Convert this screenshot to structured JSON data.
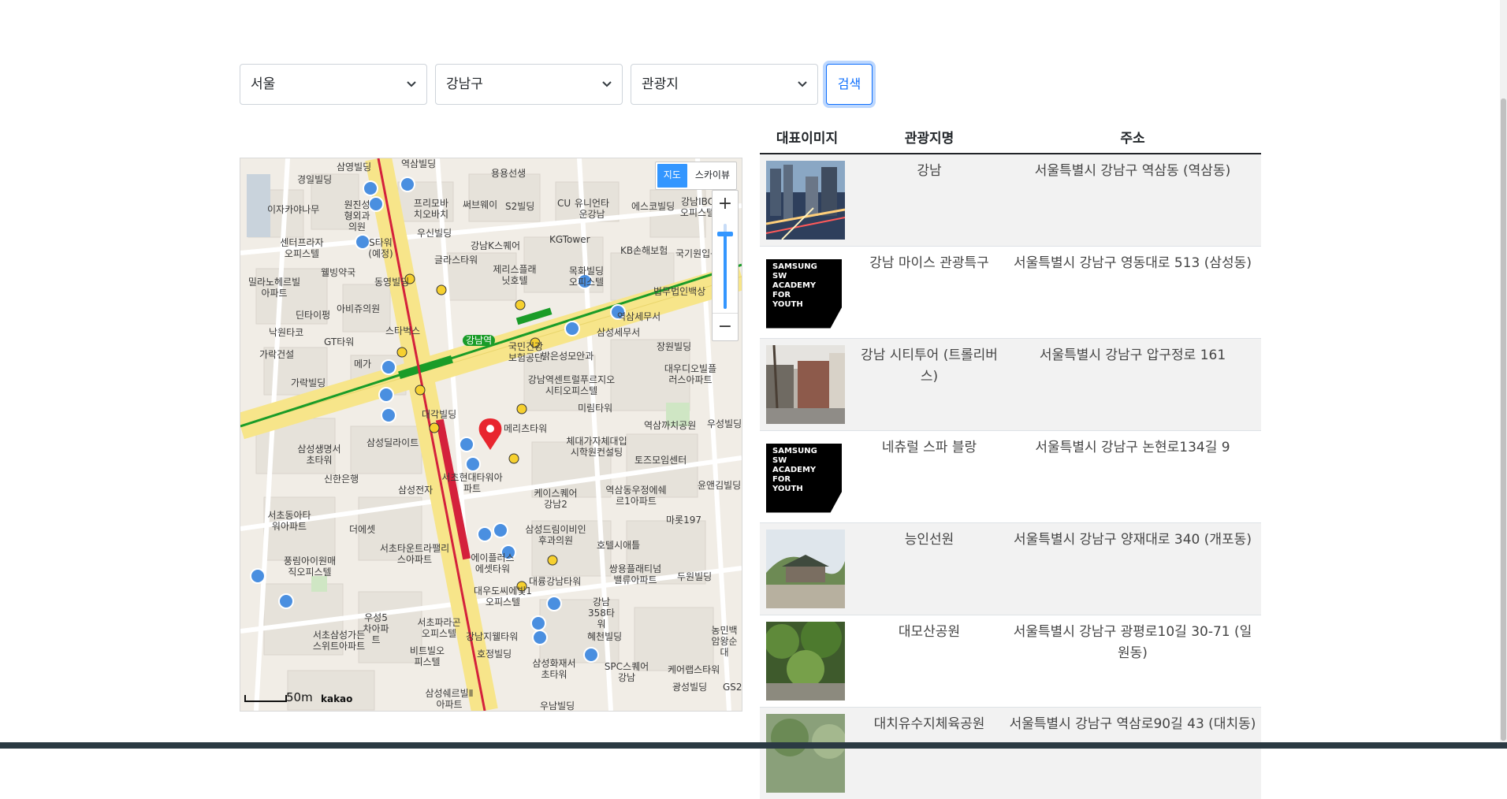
{
  "filters": {
    "sido": "서울",
    "gugun": "강남구",
    "content_type": "관광지",
    "search_label": "검색"
  },
  "map": {
    "map_type_active": "지도",
    "map_type_other": "스카이뷰",
    "zoom_in": "+",
    "zoom_out": "−",
    "scale": "50m",
    "provider": "kakao",
    "labels": [
      "삼영빌딩",
      "역삼빌딩",
      "용용선생",
      "경일빌딩",
      "이자카야나무",
      "원진성형외과의원",
      "프리모바치오바치",
      "써브웨이",
      "S2빌딩",
      "CU",
      "유니언타운강남",
      "에스코빌딩",
      "강남IBC오피스텔",
      "센터프라자오피스텔",
      "S타워(예정)",
      "우신빌딩",
      "강남K스퀘어",
      "KGTower",
      "KB손해보험",
      "국기원입구",
      "밀라노헤르빌아파트",
      "웰빙약국",
      "동영빌딩",
      "글라스타워",
      "제리스플래닛호텔",
      "목화빌딩오피스텔",
      "법무법인백상",
      "딘타이펑",
      "아비쥬의원",
      "낙원타코",
      "GT타워",
      "스타벅스",
      "역삼세무서",
      "삼성세무서",
      "가락건설",
      "메가",
      "강남역",
      "국민건강보험공단",
      "밝은성모안과",
      "장원빌딩",
      "가락빌딩",
      "강남역센트럴푸르지오시티오피스텔",
      "대우디오빌플러스아파트",
      "대각빌딩",
      "메리츠타워",
      "미림타워",
      "역삼까치공원",
      "우성빌딩",
      "삼성딜라이트",
      "체대가자체대입시학원컨설팅",
      "토즈모임센터",
      "삼성생명서초타워",
      "신한은행",
      "서초현대타워아파트",
      "삼성전자",
      "케이스퀘어강남2",
      "역삼동우정에쉐르1아파트",
      "윤앤김빌딩",
      "서초동아타워아파트",
      "더에셋",
      "삼성드림이비인후과의원",
      "마롯197",
      "서초타운트라팰리스아파트",
      "호텔시애틀",
      "풍림아이원매직오피스텔",
      "에이플러스에셋타워",
      "대륭강남타워",
      "쌍용플래티넘밸류아파트",
      "두원빌딩",
      "대우도씨에빛1오피스텔",
      "강남358타워",
      "우성5차아파트",
      "서초파라곤오피스텔",
      "서초삼성가든스위트아파트",
      "강남지웰타워",
      "비트빌오피스텔",
      "호정빌딩",
      "혜천빌딩",
      "농민백암왕순대",
      "삼성화재서초타워",
      "SPC스퀘어강남",
      "케어랩스타워",
      "광성빌딩",
      "GS25",
      "삼성쉐르빌Ⅱ아파트",
      "우남빌딩"
    ]
  },
  "table": {
    "headers": [
      "대표이미지",
      "관광지명",
      "주소"
    ],
    "rows": [
      {
        "name": "강남",
        "address": "서울특별시 강남구 역삼동 (역삼동)",
        "image": "photo-night-intersection"
      },
      {
        "name": "강남 마이스 관광특구",
        "address": "서울특별시 강남구 영동대로 513 (삼성동)",
        "image": "samsung-sw-academy-logo"
      },
      {
        "name": "강남 시티투어 (트롤리버스)",
        "address": "서울특별시 강남구 압구정로 161",
        "image": "photo-street"
      },
      {
        "name": "네츄럴 스파 블랑",
        "address": "서울특별시 강남구 논현로134길 9",
        "image": "samsung-sw-academy-logo"
      },
      {
        "name": "능인선원",
        "address": "서울특별시 강남구 양재대로 340 (개포동)",
        "image": "photo-temple"
      },
      {
        "name": "대모산공원",
        "address": "서울특별시 강남구 광평로10길 30-71 (일원동)",
        "image": "photo-forest"
      },
      {
        "name": "대치유수지체육공원",
        "address": "서울특별시 강남구 역삼로90길 43 (대치동)",
        "image": "photo-park"
      }
    ],
    "logo_text": "SAMSUNG\nSW\nACADEMY\nFOR\nYOUTH"
  },
  "colors": {
    "primary": "#0d6efd",
    "map_road_main": "#f7e58a",
    "metro_line_2": "#1a9c28",
    "shinbundang_line": "#d4213c",
    "map_btn_active": "#3396ff"
  }
}
